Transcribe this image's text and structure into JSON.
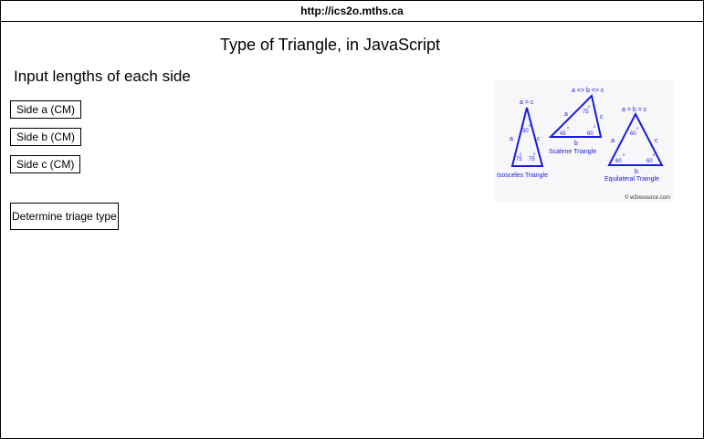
{
  "window": {
    "url": "http://ics2o.mths.ca"
  },
  "page": {
    "title": "Type of Triangle, in JavaScript",
    "subtitle": "Input lengths of each side"
  },
  "inputs": [
    {
      "placeholder": "Side a (CM)"
    },
    {
      "placeholder": "Side b (CM)"
    },
    {
      "placeholder": "Side c (CM)"
    }
  ],
  "button": {
    "label": "Determine triage type"
  },
  "diagram": {
    "isosceles": {
      "header": "a = c",
      "caption": "Isosceles Triangle",
      "a": "a",
      "c": "c",
      "top_angle": "30",
      "left_angle": "75",
      "right_angle": "75",
      "deg": "0"
    },
    "scalene": {
      "header": "a <> b <> c",
      "caption": "Scalene Triangle",
      "a": "a",
      "b": "b",
      "c": "c",
      "top_angle": "75",
      "left_angle": "45",
      "right_angle": "60",
      "deg": "0"
    },
    "equilateral": {
      "header": "a = b = c",
      "caption": "Equilateral Traingle",
      "a": "a",
      "b": "b",
      "c": "c",
      "top_angle": "60",
      "left_angle": "60",
      "right_angle": "60",
      "deg": "0"
    },
    "credit": "© w3resource.com",
    "color": "#1a1adb"
  }
}
